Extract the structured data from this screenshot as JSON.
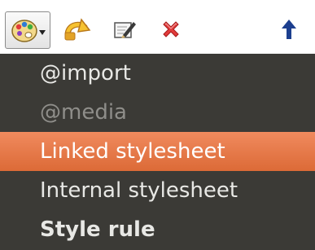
{
  "toolbar": {
    "buttons": [
      {
        "name": "insert-style-button",
        "icon": "palette-icon",
        "has_dropdown": true,
        "active": true
      },
      {
        "name": "undo-button",
        "icon": "undo-arrow-icon"
      },
      {
        "name": "edit-button",
        "icon": "edit-pencil-icon"
      },
      {
        "name": "delete-button",
        "icon": "red-x-icon"
      },
      {
        "name": "move-up-button",
        "icon": "up-arrow-icon"
      }
    ]
  },
  "menu": {
    "items": [
      {
        "label": "@import",
        "state": "normal"
      },
      {
        "label": "@media",
        "state": "disabled"
      },
      {
        "label": "Linked stylesheet",
        "state": "selected"
      },
      {
        "label": "Internal stylesheet",
        "state": "normal"
      },
      {
        "label": "Style rule",
        "state": "bold"
      }
    ]
  },
  "colors": {
    "menu_background": "#3b3a36",
    "selection": "#e47543",
    "text": "#e8e8e5",
    "disabled_text": "#8f8e8a",
    "delete_red": "#e23b3b",
    "up_arrow_blue": "#1c3f8f"
  }
}
